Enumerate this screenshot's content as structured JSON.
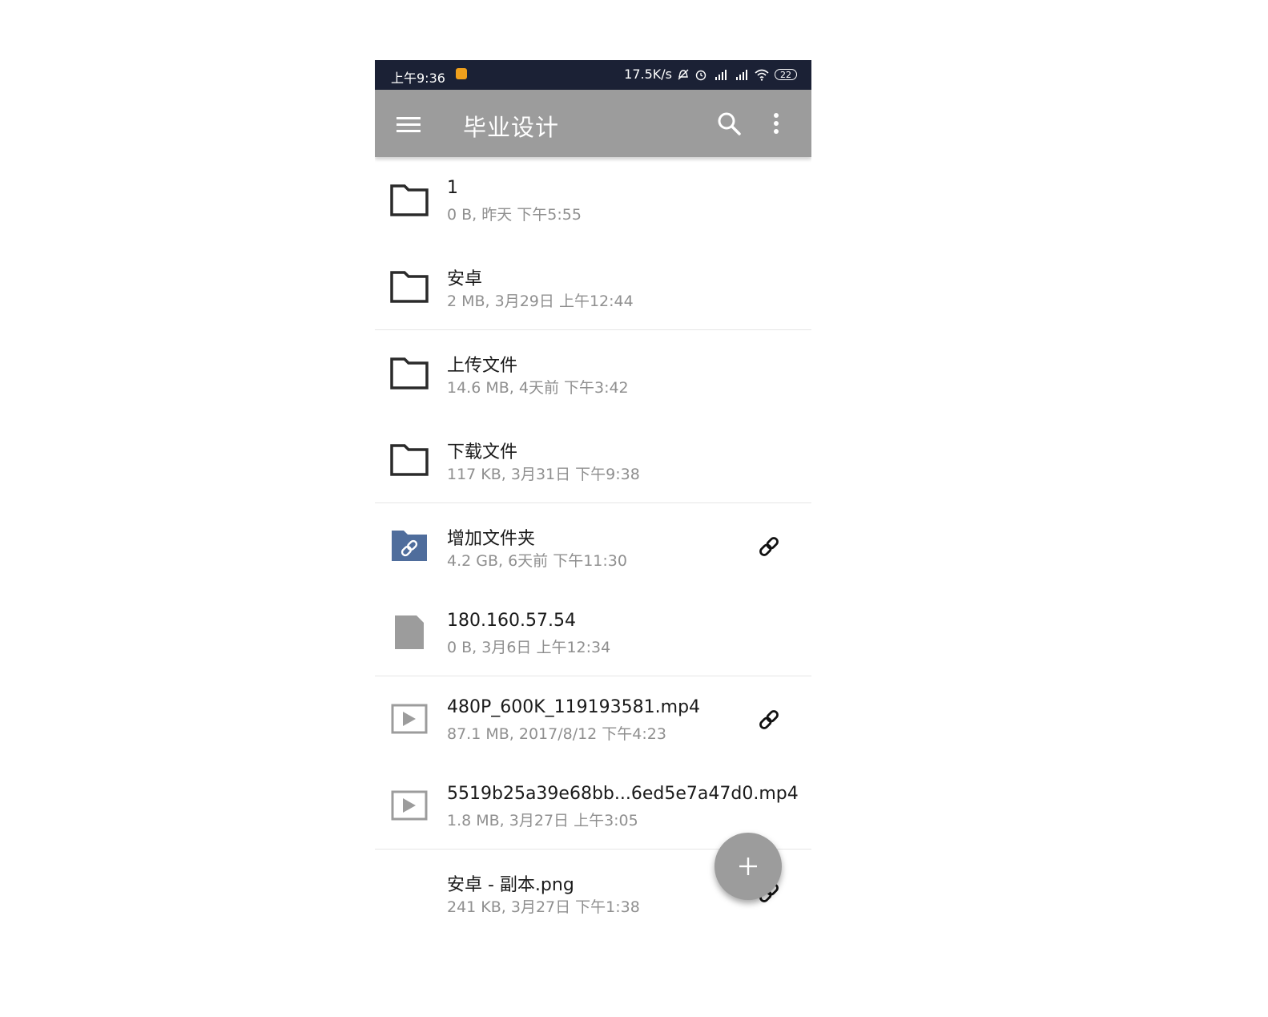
{
  "status_bar": {
    "time": "上午9:36",
    "network_speed": "17.5K/s",
    "battery": "22"
  },
  "toolbar": {
    "title": "毕业设计",
    "icons": [
      "menu-icon",
      "search-icon",
      "more-vert-icon"
    ]
  },
  "files": [
    {
      "name": "1",
      "meta": "0 B, 昨天 下午5:55",
      "icon": "folder-icon",
      "shared": false
    },
    {
      "name": "安卓",
      "meta": "2 MB, 3月29日 上午12:44",
      "icon": "folder-icon",
      "shared": false
    },
    {
      "name": "上传文件",
      "meta": "14.6 MB, 4天前 下午3:42",
      "icon": "folder-icon",
      "shared": false
    },
    {
      "name": "下载文件",
      "meta": "117 KB, 3月31日 下午9:38",
      "icon": "folder-icon",
      "shared": false
    },
    {
      "name": "增加文件夹",
      "meta": "4.2 GB, 6天前 下午11:30",
      "icon": "shared-folder-icon",
      "shared": true
    },
    {
      "name": "180.160.57.54",
      "meta": "0 B, 3月6日 上午12:34",
      "icon": "file-icon",
      "shared": false
    },
    {
      "name": "480P_600K_119193581.mp4",
      "meta": "87.1 MB, 2017/8/12 下午4:23",
      "icon": "video-icon",
      "shared": true
    },
    {
      "name": "5519b25a39e68bb...6ed5e7a47d0.mp4",
      "meta": "1.8 MB, 3月27日 上午3:05",
      "icon": "video-icon",
      "shared": false
    },
    {
      "name": "安卓 - 副本.png",
      "meta": "241 KB, 3月27日 下午1:38",
      "icon": "image-icon",
      "shared": true
    }
  ],
  "fab": {
    "icon": "add-icon"
  },
  "colors": {
    "status_bar": "#1b2135",
    "toolbar": "#9c9c9c",
    "shared_folder": "#4f6d9c",
    "meta_text": "#8f8f8f"
  }
}
